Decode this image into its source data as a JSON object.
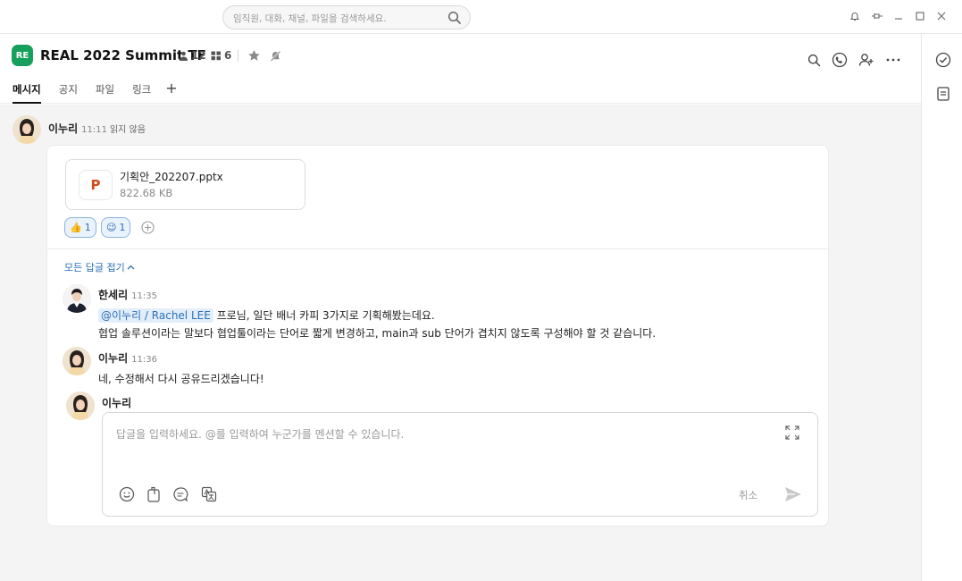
{
  "search": {
    "placeholder": "임직원, 대화, 채널, 파일을 검색하세요."
  },
  "channel": {
    "badge": "RE",
    "title": "REAL 2022 Summit TF",
    "members": "12",
    "groups": "6"
  },
  "tabs": [
    {
      "label": "메시지"
    },
    {
      "label": "공지"
    },
    {
      "label": "파일"
    },
    {
      "label": "링크"
    }
  ],
  "message": {
    "author": "이누리",
    "time": "11:11",
    "status": "읽지 않음",
    "file": {
      "icon_letter": "P",
      "name": "기획안_202207.pptx",
      "size": "822.68 KB"
    },
    "reactions": [
      {
        "emoji": "👍",
        "count": "1"
      },
      {
        "emoji": "😉",
        "count": "1"
      }
    ]
  },
  "thread": {
    "collapse_label": "모든 답글 접기",
    "replies": [
      {
        "author": "한세리",
        "time": "11:35",
        "mention": "@이누리 / Rachel LEE",
        "line1": " 프로님, 일단 배너 카피 3가지로 기획해봤는데요.",
        "line2": "협업 솔루션이라는 말보다 협업툴이라는 단어로 짧게 변경하고, main과 sub 단어가 겹치지 않도록 구성해야 할 것 같습니다."
      },
      {
        "author": "이누리",
        "time": "11:36",
        "text": "네, 수정해서 다시 공유드리겠습니다!"
      }
    ]
  },
  "composer": {
    "author": "이누리",
    "placeholder": "답글을 입력하세요. @를 입력하여 누군가를 멘션할 수 있습니다.",
    "cancel_label": "취소"
  },
  "colors": {
    "badge": "#17a05d",
    "accent": "#2f6fb6",
    "file_icon": "#d24b1d"
  }
}
